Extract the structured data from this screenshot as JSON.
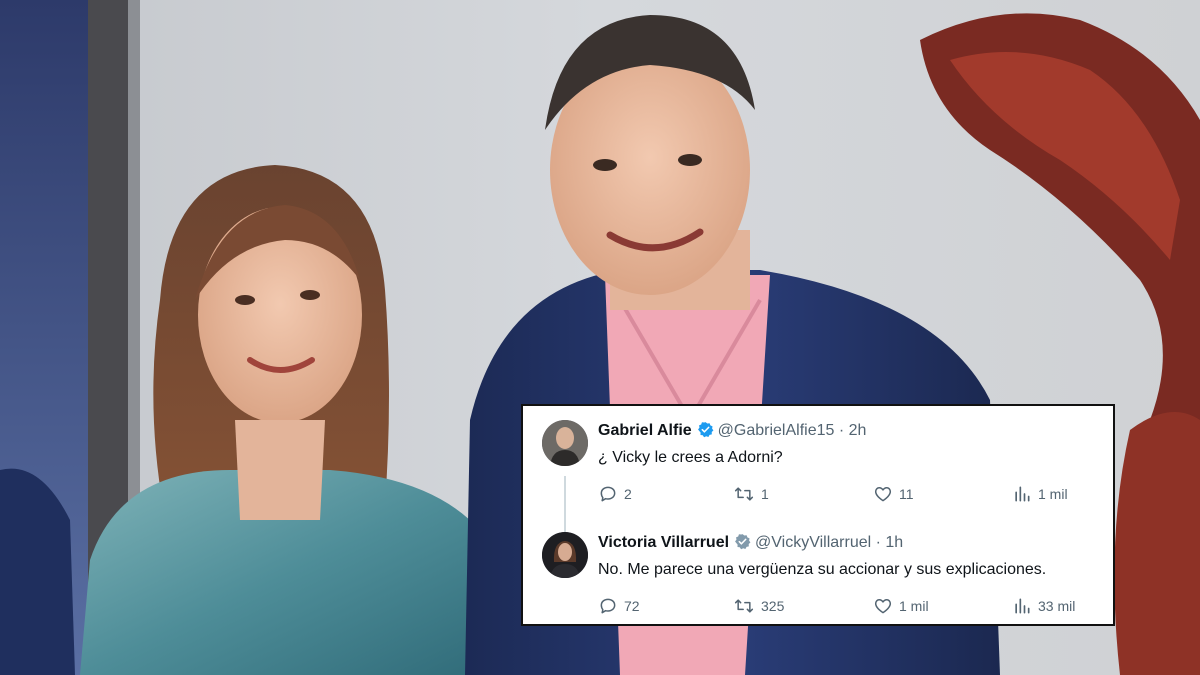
{
  "colors": {
    "card_bg": "#ffffff",
    "verified": "#1d9bf0",
    "text": "#0f1419",
    "muted": "#536471"
  },
  "tweets": [
    {
      "name": "Gabriel Alfie",
      "handle": "@GabrielAlfie15",
      "time": "· 2h",
      "verified_badge": "blue",
      "text": "¿ Vicky le crees a Adorni?",
      "replies": "2",
      "retweets": "1",
      "likes": "11",
      "views": "1 mil"
    },
    {
      "name": "Victoria Villarruel",
      "handle": "@VickyVillarruel",
      "time": "· 1h",
      "verified_badge": "gray",
      "text": "No. Me parece una vergüenza su accionar y sus explicaciones.",
      "replies": "72",
      "retweets": "325",
      "likes": "1 mil",
      "views": "33 mil"
    }
  ],
  "icons": [
    "reply-icon",
    "retweet-icon",
    "like-icon",
    "views-icon",
    "verified-icon"
  ]
}
